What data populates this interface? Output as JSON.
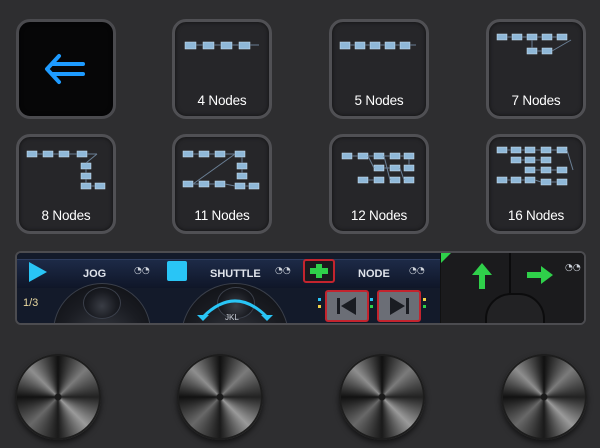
{
  "keys": [
    {
      "label": ""
    },
    {
      "label": "4 Nodes"
    },
    {
      "label": "5 Nodes"
    },
    {
      "label": "7 Nodes"
    },
    {
      "label": "8 Nodes"
    },
    {
      "label": "11 Nodes"
    },
    {
      "label": "12 Nodes"
    },
    {
      "label": "16 Nodes"
    }
  ],
  "strip": {
    "jog_label": "JOG",
    "shuttle_label": "SHUTTLE",
    "node_label": "NODE",
    "jkl_label": "JKL",
    "counter": "1/3"
  },
  "icons": {
    "back": "back-arrow-icon",
    "play": "play-icon",
    "stop": "stop-icon",
    "add": "add-node-icon",
    "prev": "prev-node-icon",
    "next": "next-node-icon",
    "up": "up-arrow-icon",
    "right": "right-arrow-icon",
    "lock": "lock-icon"
  },
  "colors": {
    "accent_blue": "#1e9bff",
    "cyan": "#29c5f6",
    "green": "#2fd04a",
    "red_frame": "#c3242e"
  }
}
